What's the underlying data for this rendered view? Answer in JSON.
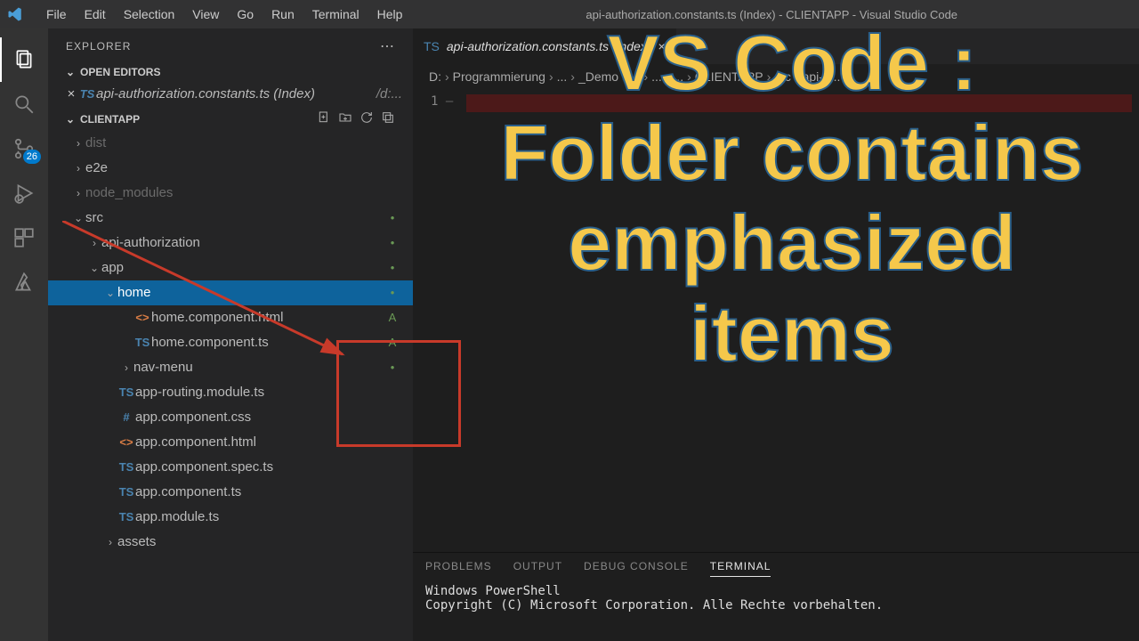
{
  "titlebar": {
    "menus": [
      "File",
      "Edit",
      "Selection",
      "View",
      "Go",
      "Run",
      "Terminal",
      "Help"
    ],
    "title": "api-authorization.constants.ts (Index) - CLIENTAPP - Visual Studio Code"
  },
  "activitybar": {
    "source_control_badge": "26"
  },
  "sidebar": {
    "title": "EXPLORER",
    "open_editors": {
      "title": "OPEN EDITORS",
      "items": [
        {
          "icon": "TS",
          "iconClass": "ts",
          "label": "api-authorization.constants.ts (Index)",
          "suffix": "/d:...",
          "closeable": true
        }
      ]
    },
    "workspace": "CLIENTAPP",
    "tree": [
      {
        "indent": 1,
        "twist": ">",
        "label": "dist",
        "dim": true
      },
      {
        "indent": 1,
        "twist": ">",
        "label": "e2e"
      },
      {
        "indent": 1,
        "twist": ">",
        "label": "node_modules",
        "dim": true
      },
      {
        "indent": 1,
        "twist": "v",
        "label": "src",
        "decor": "•"
      },
      {
        "indent": 2,
        "twist": ">",
        "label": "api-authorization",
        "decor": "•"
      },
      {
        "indent": 2,
        "twist": "v",
        "label": "app",
        "decor": "•"
      },
      {
        "indent": 3,
        "twist": "v",
        "label": "home",
        "selected": true,
        "decor": "•"
      },
      {
        "indent": 4,
        "icon": "<>",
        "iconClass": "html",
        "label": "home.component.html",
        "decor": "A"
      },
      {
        "indent": 4,
        "icon": "TS",
        "iconClass": "ts",
        "label": "home.component.ts",
        "decor": "A"
      },
      {
        "indent": 4,
        "twist": ">",
        "label": "nav-menu",
        "decor": "•"
      },
      {
        "indent": 3,
        "icon": "TS",
        "iconClass": "ts",
        "label": "app-routing.module.ts"
      },
      {
        "indent": 3,
        "icon": "#",
        "iconClass": "css",
        "label": "app.component.css"
      },
      {
        "indent": 3,
        "icon": "<>",
        "iconClass": "html",
        "label": "app.component.html"
      },
      {
        "indent": 3,
        "icon": "TS",
        "iconClass": "ts",
        "label": "app.component.spec.ts"
      },
      {
        "indent": 3,
        "icon": "TS",
        "iconClass": "ts",
        "label": "app.component.ts"
      },
      {
        "indent": 3,
        "icon": "TS",
        "iconClass": "ts",
        "label": "app.module.ts"
      },
      {
        "indent": 3,
        "twist": ">",
        "label": "assets"
      }
    ]
  },
  "editor": {
    "tab": {
      "icon": "TS",
      "label": "api-authorization.constants.ts (Index)"
    },
    "breadcrumb": [
      "D:",
      "Programmierung",
      "...",
      "_Demo",
      "...",
      "...",
      "...",
      "CLIENTAPP",
      "src",
      "api-a..."
    ],
    "line_no": "1"
  },
  "panel": {
    "tabs": [
      "PROBLEMS",
      "OUTPUT",
      "DEBUG CONSOLE",
      "TERMINAL"
    ],
    "active": 3,
    "lines": [
      "Windows PowerShell",
      "Copyright (C) Microsoft Corporation. Alle Rechte vorbehalten."
    ]
  },
  "overlay": "VS Code : Folder contains emphasized items"
}
